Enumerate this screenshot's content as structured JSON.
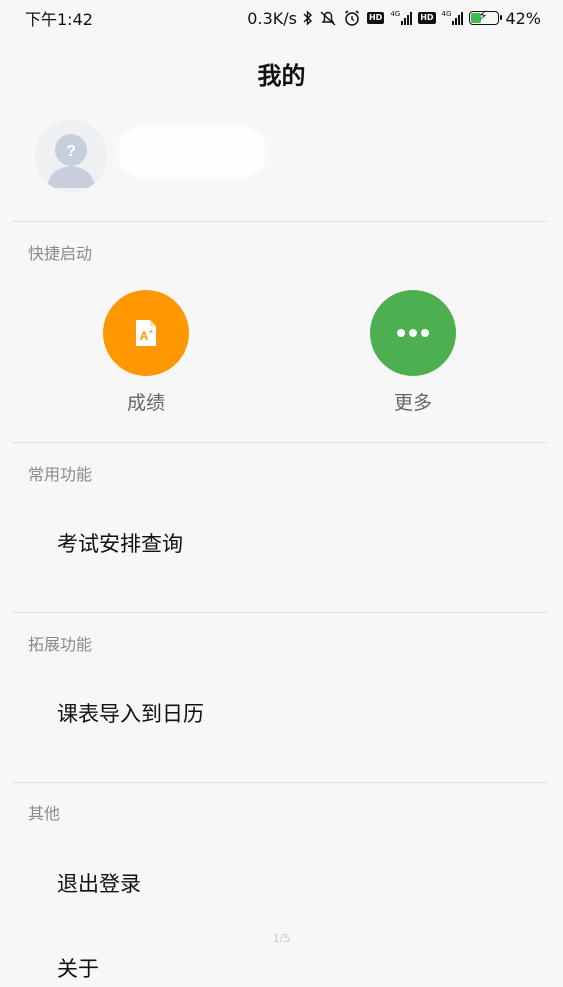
{
  "status_bar": {
    "time": "下午1:42",
    "net_speed": "0.3K/s",
    "hd1": "HD",
    "net1": "4G",
    "hd2": "HD",
    "net2": "4G",
    "battery_percent": "42%",
    "battery_level": 0.42,
    "icons": [
      "bluetooth-icon",
      "mute-alarm-icon",
      "alarm-clock-icon",
      "signal-icon",
      "battery-icon"
    ]
  },
  "header": {
    "title": "我的"
  },
  "profile": {
    "avatar_icon": "default-avatar-icon"
  },
  "quick_launch": {
    "label": "快捷启动",
    "items": [
      {
        "label": "成绩",
        "icon": "grade-doc-icon",
        "color": "#ff9800"
      },
      {
        "label": "更多",
        "icon": "more-dots-icon",
        "color": "#4caf50"
      }
    ]
  },
  "common": {
    "label": "常用功能",
    "items": [
      {
        "label": "考试安排查询"
      }
    ]
  },
  "extended": {
    "label": "拓展功能",
    "items": [
      {
        "label": "课表导入到日历"
      }
    ]
  },
  "other": {
    "label": "其他",
    "items": [
      {
        "label": "退出登录"
      },
      {
        "label": "关于"
      }
    ]
  },
  "pager": {
    "text": "1/5"
  }
}
